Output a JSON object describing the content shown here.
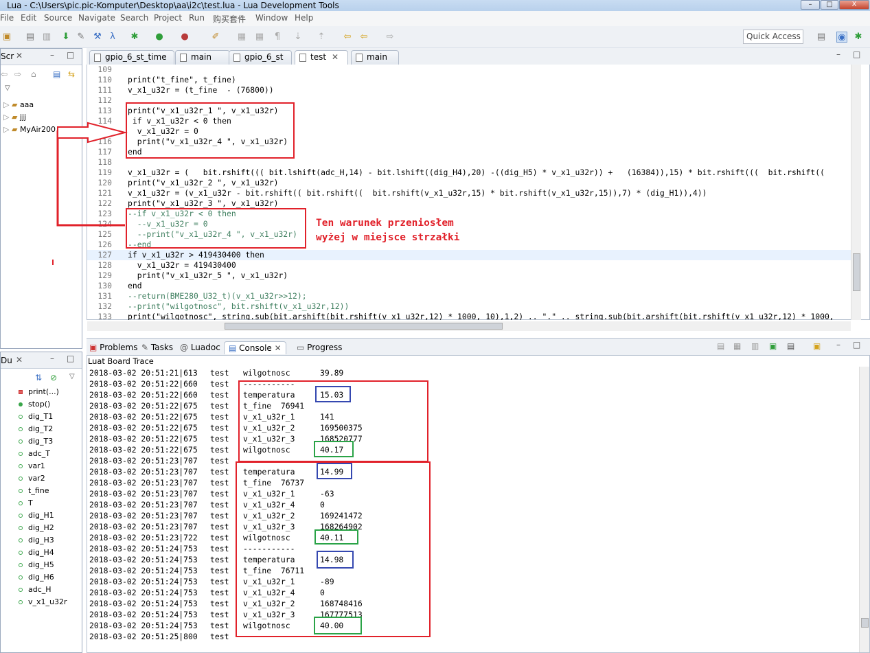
{
  "window": {
    "title": "Lua - C:\\Users\\pic.pic-Komputer\\Desktop\\aa\\i2c\\test.lua - Lua Development Tools",
    "controls": [
      "–",
      "□",
      "X"
    ]
  },
  "menu": [
    "File",
    "Edit",
    "Source",
    "Navigate",
    "Search",
    "Project",
    "Run",
    "购买套件",
    "Window",
    "Help"
  ],
  "toolbar": {
    "quick_access": "Quick Access"
  },
  "script_explorer": {
    "tab_label": "Scr",
    "items": [
      "aaa",
      "jjj",
      "MyAir200"
    ]
  },
  "debug_panel": {
    "tab_label": "Du",
    "items": [
      "print(...)",
      "stop()",
      "dig_T1",
      "dig_T2",
      "dig_T3",
      "adc_T",
      "var1",
      "var2",
      "t_fine",
      "T",
      "dig_H1",
      "dig_H2",
      "dig_H3",
      "dig_H4",
      "dig_H5",
      "dig_H6",
      "adc_H",
      "v_x1_u32r"
    ]
  },
  "editor": {
    "tabs": [
      "gpio_6_st_time",
      "main",
      "gpio_6_st",
      "test",
      "main"
    ],
    "active_tab": 3,
    "lines": [
      {
        "n": "109",
        "code": ""
      },
      {
        "n": "110",
        "code": "print(\"t_fine\", t_fine)"
      },
      {
        "n": "111",
        "code": "v_x1_u32r = (t_fine  - (76800))"
      },
      {
        "n": "112",
        "code": ""
      },
      {
        "n": "113",
        "code": "print(\"v_x1_u32r_1 \", v_x1_u32r)"
      },
      {
        "n": "114",
        "code": " if v_x1_u32r < 0 then"
      },
      {
        "n": "115",
        "code": "  v_x1_u32r = 0"
      },
      {
        "n": "116",
        "code": "  print(\"v_x1_u32r_4 \", v_x1_u32r)"
      },
      {
        "n": "117",
        "code": "end"
      },
      {
        "n": "118",
        "code": ""
      },
      {
        "n": "119",
        "code": "v_x1_u32r = (   bit.rshift((( bit.lshift(adc_H,14) - bit.lshift((dig_H4),20) -((dig_H5) * v_x1_u32r)) +   (16384)),15) * bit.rshift(((  bit.rshift(("
      },
      {
        "n": "120",
        "code": "print(\"v_x1_u32r_2 \", v_x1_u32r)"
      },
      {
        "n": "121",
        "code": "v_x1_u32r = (v_x1_u32r - bit.rshift(( bit.rshift((  bit.rshift(v_x1_u32r,15) * bit.rshift(v_x1_u32r,15)),7) * (dig_H1)),4))"
      },
      {
        "n": "122",
        "code": "print(\"v_x1_u32r_3 \", v_x1_u32r)"
      },
      {
        "n": "123",
        "code": "--if v_x1_u32r < 0 then"
      },
      {
        "n": "124",
        "code": "  --v_x1_u32r = 0"
      },
      {
        "n": "125",
        "code": "  --print(\"v_x1_u32r_4 \", v_x1_u32r)"
      },
      {
        "n": "126",
        "code": "--end"
      },
      {
        "n": "127",
        "code": "if v_x1_u32r > 419430400 then"
      },
      {
        "n": "128",
        "code": "  v_x1_u32r = 419430400"
      },
      {
        "n": "129",
        "code": "  print(\"v_x1_u32r_5 \", v_x1_u32r)"
      },
      {
        "n": "130",
        "code": "end"
      },
      {
        "n": "131",
        "code": "--return(BME280_U32_t)(v_x1_u32r>>12);"
      },
      {
        "n": "132",
        "code": "--print(\"wilgotnosc\", bit.rshift(v_x1_u32r,12))"
      },
      {
        "n": "133",
        "code": "print(\"wilgotnosc\", string.sub(bit.arshift(bit.rshift(v_x1_u32r,12) * 1000, 10),1,2) .. \".\" .. string.sub(bit.arshift(bit.rshift(v_x1_u32r,12) * 1000,"
      }
    ],
    "annotation": [
      "Ten warunek przeniosłem",
      "wyżej w miejsce strzałki"
    ],
    "annotation_color": "#e1212a"
  },
  "console": {
    "tabs": [
      "Problems",
      "Tasks",
      "Luadoc",
      "Console",
      "Progress"
    ],
    "active_tab": 3,
    "title": "Luat Board Trace",
    "rows": [
      {
        "ts": "2018-03-02 20:51:21|613",
        "src": "test",
        "key": "wilgotnosc",
        "val": "39.89"
      },
      {
        "ts": "2018-03-02 20:51:22|660",
        "src": "test",
        "key": "-----------",
        "val": ""
      },
      {
        "ts": "2018-03-02 20:51:22|660",
        "src": "test",
        "key": "temperatura",
        "val": "15.03"
      },
      {
        "ts": "2018-03-02 20:51:22|675",
        "src": "test",
        "key": "t_fine  76941",
        "val": ""
      },
      {
        "ts": "2018-03-02 20:51:22|675",
        "src": "test",
        "key": "v_x1_u32r_1",
        "val": "141"
      },
      {
        "ts": "2018-03-02 20:51:22|675",
        "src": "test",
        "key": "v_x1_u32r_2",
        "val": "169500375"
      },
      {
        "ts": "2018-03-02 20:51:22|675",
        "src": "test",
        "key": "v_x1_u32r_3",
        "val": "168520777"
      },
      {
        "ts": "2018-03-02 20:51:22|675",
        "src": "test",
        "key": "wilgotnosc",
        "val": "40.17"
      },
      {
        "ts": "2018-03-02 20:51:23|707",
        "src": "test",
        "key": "",
        "val": ""
      },
      {
        "ts": "2018-03-02 20:51:23|707",
        "src": "test",
        "key": "temperatura",
        "val": "14.99"
      },
      {
        "ts": "2018-03-02 20:51:23|707",
        "src": "test",
        "key": "t_fine  76737",
        "val": ""
      },
      {
        "ts": "2018-03-02 20:51:23|707",
        "src": "test",
        "key": "v_x1_u32r_1",
        "val": "-63"
      },
      {
        "ts": "2018-03-02 20:51:23|707",
        "src": "test",
        "key": "v_x1_u32r_4",
        "val": "0"
      },
      {
        "ts": "2018-03-02 20:51:23|707",
        "src": "test",
        "key": "v_x1_u32r_2",
        "val": "169241472"
      },
      {
        "ts": "2018-03-02 20:51:23|707",
        "src": "test",
        "key": "v_x1_u32r_3",
        "val": "168264902"
      },
      {
        "ts": "2018-03-02 20:51:23|722",
        "src": "test",
        "key": "wilgotnosc",
        "val": "40.11"
      },
      {
        "ts": "2018-03-02 20:51:24|753",
        "src": "test",
        "key": "-----------",
        "val": ""
      },
      {
        "ts": "2018-03-02 20:51:24|753",
        "src": "test",
        "key": "temperatura",
        "val": "14.98"
      },
      {
        "ts": "2018-03-02 20:51:24|753",
        "src": "test",
        "key": "t_fine  76711",
        "val": ""
      },
      {
        "ts": "2018-03-02 20:51:24|753",
        "src": "test",
        "key": "v_x1_u32r_1",
        "val": "-89"
      },
      {
        "ts": "2018-03-02 20:51:24|753",
        "src": "test",
        "key": "v_x1_u32r_4",
        "val": "0"
      },
      {
        "ts": "2018-03-02 20:51:24|753",
        "src": "test",
        "key": "v_x1_u32r_2",
        "val": "168748416"
      },
      {
        "ts": "2018-03-02 20:51:24|753",
        "src": "test",
        "key": "v_x1_u32r_3",
        "val": "167777513"
      },
      {
        "ts": "2018-03-02 20:51:24|753",
        "src": "test",
        "key": "wilgotnosc",
        "val": "40.00"
      },
      {
        "ts": "2018-03-02 20:51:25|800",
        "src": "test",
        "key": "",
        "val": ""
      }
    ]
  },
  "colors": {
    "highlight_red": "#e1212a",
    "highlight_blue": "#3548b0",
    "highlight_green": "#2aa347",
    "comment": "#3f7f5f",
    "current_line": "#e8f2fe"
  }
}
